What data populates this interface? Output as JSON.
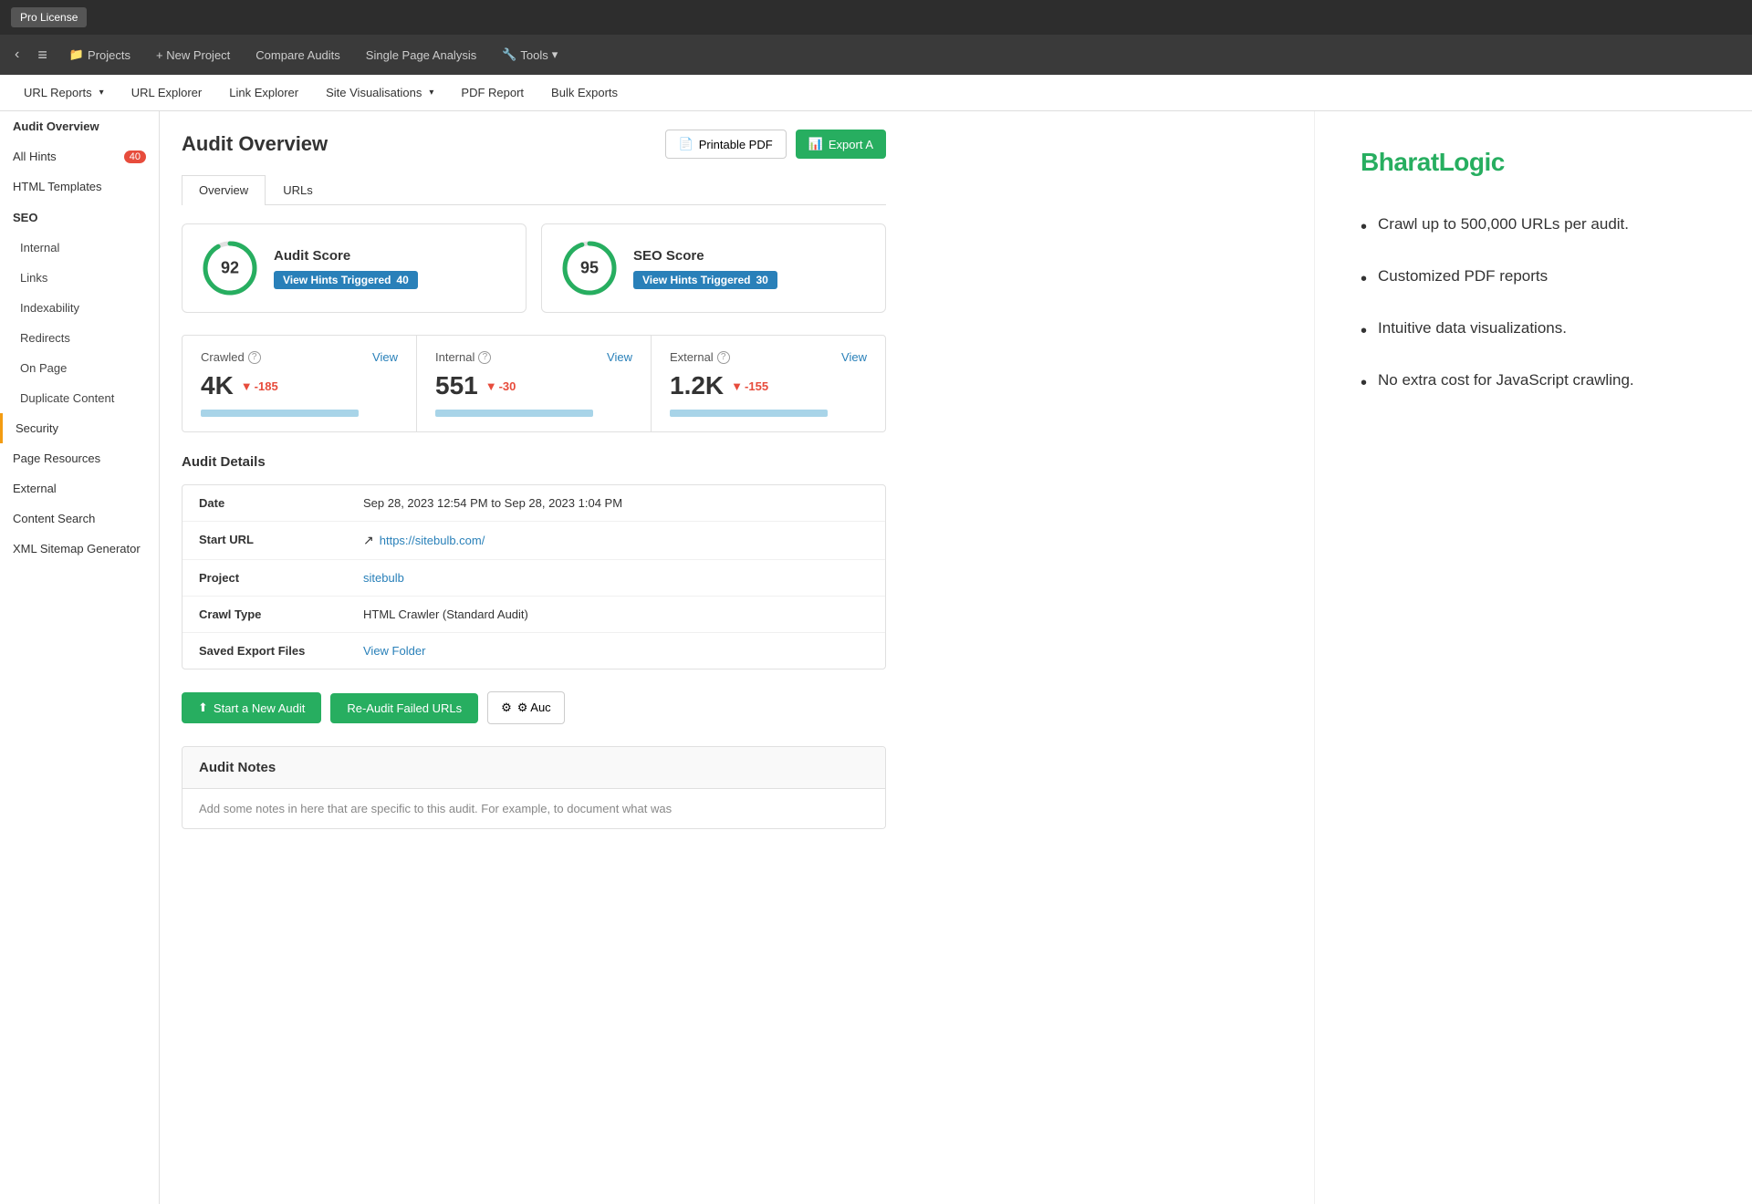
{
  "topBar": {
    "proLicenseLabel": "Pro License"
  },
  "navBar": {
    "backArrow": "‹",
    "hamburger": "≡",
    "projects": "Projects",
    "newProject": "+ New Project",
    "compareAudits": "Compare Audits",
    "singlePageAnalysis": "Single Page Analysis",
    "tools": "Tools"
  },
  "subNav": {
    "urlReports": "URL Reports",
    "urlExplorer": "URL Explorer",
    "linkExplorer": "Link Explorer",
    "siteVisualisations": "Site Visualisations",
    "pdfReport": "PDF Report",
    "bulkExports": "Bulk Exports"
  },
  "sidebar": {
    "auditOverview": "Audit Overview",
    "allHints": "All Hints",
    "allHintsBadge": "40",
    "htmlTemplates": "HTML Templates",
    "seo": "SEO",
    "internal": "Internal",
    "links": "Links",
    "indexability": "Indexability",
    "redirects": "Redirects",
    "onPage": "On Page",
    "duplicateContent": "Duplicate Content",
    "security": "Security",
    "pageResources": "Page Resources",
    "external": "External",
    "contentSearch": "Content Search",
    "xmlSitemapGenerator": "XML Sitemap Generator"
  },
  "content": {
    "pageTitle": "Audit Overview",
    "printablePDF": "Printable PDF",
    "exportA": "Export A",
    "tabs": [
      "Overview",
      "URLs"
    ],
    "activeTab": "Overview",
    "auditScore": {
      "label": "Audit Score",
      "score": 92,
      "badgeLabel": "View Hints Triggered",
      "badgeCount": "40",
      "circlePercent": 92
    },
    "seoScore": {
      "label": "SEO Score",
      "score": 95,
      "badgeLabel": "View Hints Triggered",
      "badgeCount": "30",
      "circlePercent": 95
    },
    "stats": {
      "crawled": {
        "label": "Crawled",
        "viewLabel": "View",
        "value": "4K",
        "delta": "-185"
      },
      "internal": {
        "label": "Internal",
        "viewLabel": "View",
        "value": "551",
        "delta": "-30"
      },
      "external": {
        "label": "External",
        "viewLabel": "View",
        "value": "1.2K",
        "delta": "-155"
      }
    },
    "auditDetails": {
      "sectionTitle": "Audit Details",
      "rows": [
        {
          "key": "Date",
          "value": "Sep 28, 2023 12:54 PM to Sep 28, 2023 1:04 PM",
          "type": "text"
        },
        {
          "key": "Start URL",
          "value": "https://sitebulb.com/",
          "type": "link-icon"
        },
        {
          "key": "Project",
          "value": "sitebulb",
          "type": "link"
        },
        {
          "key": "Crawl Type",
          "value": "HTML Crawler (Standard Audit)",
          "type": "text"
        },
        {
          "key": "Saved Export Files",
          "value": "View Folder",
          "type": "link"
        }
      ]
    },
    "actions": {
      "startNewAudit": "Start a New Audit",
      "reAuditFailed": "Re-Audit Failed URLs",
      "auditSettings": "⚙ Auc"
    },
    "auditNotes": {
      "sectionTitle": "Audit Notes",
      "placeholder": "Add some notes in here that are specific to this audit. For example, to document what was"
    }
  },
  "rightPanel": {
    "brandName": "Bharat",
    "brandNameAccent": "Logic",
    "features": [
      "Crawl up to 500,000 URLs per audit.",
      "Customized PDF reports",
      "Intuitive data visualizations.",
      "No extra cost for JavaScript crawling."
    ]
  }
}
